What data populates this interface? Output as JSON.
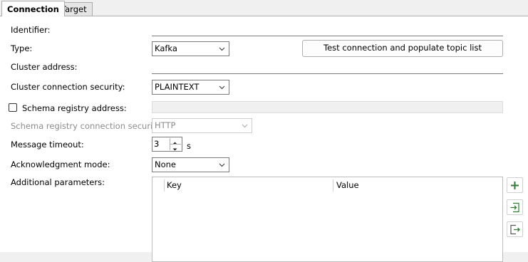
{
  "tabs": [
    "Connection",
    "Target"
  ],
  "identifier": {
    "label": "Identifier:",
    "value": ""
  },
  "type": {
    "label": "Type:",
    "value": "Kafka"
  },
  "test_button": "Test connection and populate topic list",
  "cluster_address": {
    "label": "Cluster address:",
    "value": ""
  },
  "cluster_security": {
    "label": "Cluster connection security:",
    "value": "PLAINTEXT"
  },
  "schema_registry": {
    "label": "Schema registry address:",
    "checked": false,
    "value": ""
  },
  "schema_security": {
    "label": "Schema registry connection security:",
    "value": "HTTP"
  },
  "message_timeout": {
    "label": "Message timeout:",
    "value": "3",
    "unit": "s"
  },
  "ack_mode": {
    "label": "Acknowledgment mode:",
    "value": "None"
  },
  "additional": {
    "label": "Additional parameters:",
    "columns": [
      "Key",
      "Value"
    ]
  },
  "side_buttons": [
    "plus-icon",
    "import-icon",
    "export-icon"
  ],
  "colors": {
    "accent_green": "#2e7d32",
    "border": "#7a7a7a",
    "disabled_text": "#8c8c8c"
  }
}
